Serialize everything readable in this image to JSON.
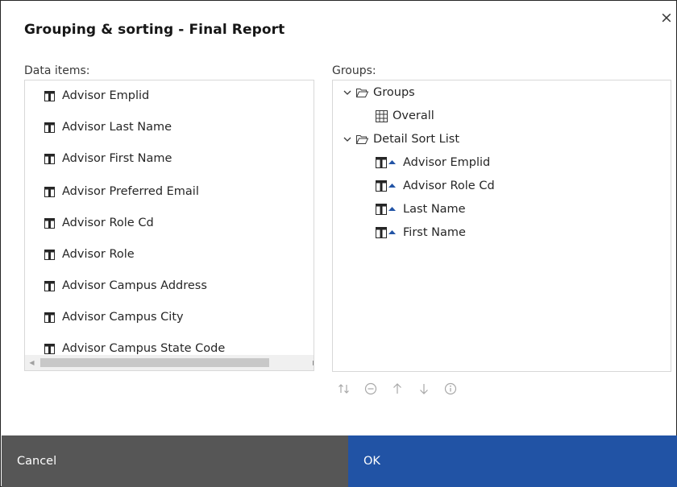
{
  "dialog": {
    "title": "Grouping & sorting - Final Report",
    "close_glyph": "×"
  },
  "data_items": {
    "label": "Data items:",
    "items": [
      "Advisor Emplid",
      "Advisor Last Name",
      "Advisor First Name",
      "Advisor Preferred Email",
      "Advisor Role Cd",
      "Advisor Role",
      "Advisor Campus Address",
      "Advisor Campus City",
      "Advisor Campus State Code"
    ],
    "item_icon": "text-data-item-icon"
  },
  "groups": {
    "label": "Groups:",
    "tree": {
      "groups_folder": "Groups",
      "overall": "Overall",
      "detail_folder": "Detail Sort List",
      "sort_items": [
        "Advisor Emplid",
        "Advisor Role Cd",
        "Last Name",
        "First Name"
      ]
    },
    "sort_icon": "text-item-ascending-sort-icon"
  },
  "toolbar": {
    "icons": [
      "sort-toggle-icon",
      "remove-icon",
      "move-up-icon",
      "move-down-icon",
      "info-icon"
    ]
  },
  "footer": {
    "cancel_label": "Cancel",
    "ok_label": "OK"
  },
  "colors": {
    "ok_bg": "#2153a5",
    "cancel_bg": "#565656",
    "sort_arrow": "#2153a5"
  }
}
